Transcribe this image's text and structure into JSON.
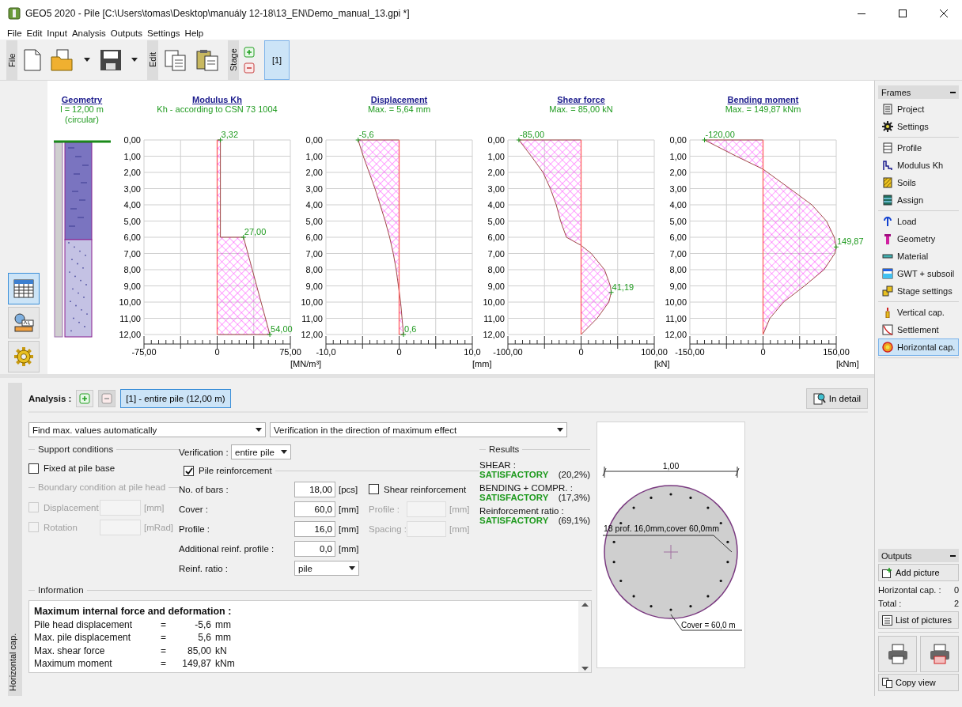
{
  "window": {
    "title": "GEO5 2020 - Pile [C:\\Users\\tomas\\Desktop\\manuály 12-18\\13_EN\\Demo_manual_13.gpi *]"
  },
  "menu": [
    "File",
    "Edit",
    "Input",
    "Analysis",
    "Outputs",
    "Settings",
    "Help"
  ],
  "toolbar": {
    "groups": [
      {
        "label": "File"
      },
      {
        "label": "Edit"
      },
      {
        "label": "Stage"
      }
    ],
    "stages": [
      {
        "label": "[1]",
        "selected": true
      }
    ]
  },
  "view_buttons": [
    {
      "kind": "table",
      "selected": true
    },
    {
      "kind": "labels",
      "selected": false
    },
    {
      "kind": "settings",
      "selected": false
    }
  ],
  "geometry": {
    "title": "Geometry",
    "lines": [
      "l = 12,00 m",
      "(circular)"
    ]
  },
  "charts": [
    {
      "subtitle": "Kh - according to CSN 73 1004",
      "chart_data": {
        "type": "area",
        "ref_lines": [
          {
            "axis": "x",
            "value": 0,
            "color": "#ff6060"
          }
        ],
        "title": "Modulus Kh",
        "xlabel": "[MN/m³]",
        "grid": true,
        "x": [
          0,
          3.32,
          3.32,
          27,
          54,
          0
        ],
        "xlim": [
          -75,
          75
        ],
        "ylim": [
          12,
          0
        ],
        "xticks": [
          {
            "value": -75,
            "label": "-75,00"
          },
          {
            "value": 0,
            "label": "0"
          },
          {
            "value": 75,
            "label": "75,00"
          }
        ],
        "yticks": [
          {
            "value": 0,
            "label": "0,00"
          },
          {
            "value": 1,
            "label": "1,00"
          },
          {
            "value": 2,
            "label": "2,00"
          },
          {
            "value": 3,
            "label": "3,00"
          },
          {
            "value": 4,
            "label": "4,00"
          },
          {
            "value": 5,
            "label": "5,00"
          },
          {
            "value": 6,
            "label": "6,00"
          },
          {
            "value": 7,
            "label": "7,00"
          },
          {
            "value": 8,
            "label": "8,00"
          },
          {
            "value": 9,
            "label": "9,00"
          },
          {
            "value": 10,
            "label": "10,00"
          },
          {
            "value": 11,
            "label": "11,00"
          },
          {
            "value": 12,
            "label": "12,00"
          }
        ],
        "series": [
          {
            "color": "#a04848",
            "values": [
              0,
              0,
              6,
              6,
              12,
              12
            ]
          }
        ],
        "annotations": [
          {
            "x": 3.32,
            "y": 0,
            "text": "3,32"
          },
          {
            "x": 27,
            "y": 6,
            "text": "27,00"
          },
          {
            "x": 54,
            "y": 12,
            "text": "54,00"
          }
        ]
      }
    },
    {
      "subtitle": "Max. = 5,64 mm",
      "chart_data": {
        "type": "area",
        "ref_lines": [
          {
            "axis": "x",
            "value": 0,
            "color": "#ff6060"
          }
        ],
        "title": "Displacement",
        "xlabel": "[mm]",
        "grid": true,
        "x": [
          0,
          -5.6,
          -4.9,
          -4.1,
          -3.3,
          -2.6,
          -1.9,
          -1.3,
          -0.8,
          -0.4,
          -0.1,
          0.2,
          0.4,
          0.6,
          0
        ],
        "xlim": [
          -10,
          10
        ],
        "ylim": [
          12,
          0
        ],
        "xticks": [
          {
            "value": -10,
            "label": "-10,0"
          },
          {
            "value": 0,
            "label": "0"
          },
          {
            "value": 10,
            "label": "10,0"
          }
        ],
        "yticks": [
          {
            "value": 0,
            "label": "0,00"
          },
          {
            "value": 1,
            "label": "1,00"
          },
          {
            "value": 2,
            "label": "2,00"
          },
          {
            "value": 3,
            "label": "3,00"
          },
          {
            "value": 4,
            "label": "4,00"
          },
          {
            "value": 5,
            "label": "5,00"
          },
          {
            "value": 6,
            "label": "6,00"
          },
          {
            "value": 7,
            "label": "7,00"
          },
          {
            "value": 8,
            "label": "8,00"
          },
          {
            "value": 9,
            "label": "9,00"
          },
          {
            "value": 10,
            "label": "10,00"
          },
          {
            "value": 11,
            "label": "11,00"
          },
          {
            "value": 12,
            "label": "12,00"
          }
        ],
        "series": [
          {
            "color": "#a04848",
            "values": [
              0,
              0,
              1,
              2,
              3,
              4,
              5,
              6,
              7,
              8,
              9,
              10,
              11,
              12,
              12
            ]
          }
        ],
        "annotations": [
          {
            "x": -5.6,
            "y": 0,
            "text": "-5,6"
          },
          {
            "x": 0.6,
            "y": 12,
            "text": "0,6"
          }
        ]
      }
    },
    {
      "subtitle": "Max. = 85,00 kN",
      "chart_data": {
        "type": "area",
        "ref_lines": [
          {
            "axis": "x",
            "value": 0,
            "color": "#ff6060"
          }
        ],
        "title": "Shear force",
        "xlabel": "[kN]",
        "grid": true,
        "x": [
          0,
          -85,
          -68,
          -52,
          -42,
          -34,
          -28,
          -20,
          0,
          14,
          32,
          40,
          41.19,
          38,
          22,
          0
        ],
        "xlim": [
          -100,
          100
        ],
        "ylim": [
          12,
          0
        ],
        "xticks": [
          {
            "value": -100,
            "label": "-100,00"
          },
          {
            "value": 0,
            "label": "0"
          },
          {
            "value": 100,
            "label": "100,00"
          }
        ],
        "yticks": [
          {
            "value": 0,
            "label": "0,00"
          },
          {
            "value": 1,
            "label": "1,00"
          },
          {
            "value": 2,
            "label": "2,00"
          },
          {
            "value": 3,
            "label": "3,00"
          },
          {
            "value": 4,
            "label": "4,00"
          },
          {
            "value": 5,
            "label": "5,00"
          },
          {
            "value": 6,
            "label": "6,00"
          },
          {
            "value": 7,
            "label": "7,00"
          },
          {
            "value": 8,
            "label": "8,00"
          },
          {
            "value": 9,
            "label": "9,00"
          },
          {
            "value": 10,
            "label": "10,00"
          },
          {
            "value": 11,
            "label": "11,00"
          },
          {
            "value": 12,
            "label": "12,00"
          }
        ],
        "series": [
          {
            "color": "#a04848",
            "values": [
              0,
              0,
              1,
              2,
              3,
              4,
              5,
              6,
              6.5,
              7,
              8,
              9,
              9.4,
              10,
              11,
              12
            ]
          }
        ],
        "annotations": [
          {
            "x": -85,
            "y": 0,
            "text": "-85,00"
          },
          {
            "x": 41.19,
            "y": 9.4,
            "text": "41,19"
          }
        ]
      }
    },
    {
      "subtitle": "Max. = 149,87 kNm",
      "chart_data": {
        "type": "area",
        "ref_lines": [
          {
            "axis": "x",
            "value": 0,
            "color": "#ff6060"
          }
        ],
        "title": "Bending moment",
        "xlabel": "[kNm]",
        "grid": true,
        "x": [
          0,
          -120,
          -55,
          0,
          55,
          100,
          130,
          146,
          149.87,
          147,
          125,
          85,
          42,
          14,
          0
        ],
        "xlim": [
          -150,
          150
        ],
        "ylim": [
          12,
          0
        ],
        "xticks": [
          {
            "value": -150,
            "label": "-150,00"
          },
          {
            "value": 0,
            "label": "0"
          },
          {
            "value": 150,
            "label": "150,00"
          }
        ],
        "yticks": [
          {
            "value": 0,
            "label": "0,00"
          },
          {
            "value": 1,
            "label": "1,00"
          },
          {
            "value": 2,
            "label": "2,00"
          },
          {
            "value": 3,
            "label": "3,00"
          },
          {
            "value": 4,
            "label": "4,00"
          },
          {
            "value": 5,
            "label": "5,00"
          },
          {
            "value": 6,
            "label": "6,00"
          },
          {
            "value": 7,
            "label": "7,00"
          },
          {
            "value": 8,
            "label": "8,00"
          },
          {
            "value": 9,
            "label": "9,00"
          },
          {
            "value": 10,
            "label": "10,00"
          },
          {
            "value": 11,
            "label": "11,00"
          },
          {
            "value": 12,
            "label": "12,00"
          }
        ],
        "series": [
          {
            "color": "#a04848",
            "values": [
              0,
              0,
              1,
              1.8,
              3,
              4,
              5,
              6,
              6.6,
              7,
              8,
              9,
              10,
              11,
              12
            ]
          }
        ],
        "annotations": [
          {
            "x": -120,
            "y": 0,
            "text": "-120,00"
          },
          {
            "x": 149.87,
            "y": 6.6,
            "text": "149,87"
          }
        ]
      }
    }
  ],
  "bottom_panel": {
    "tab": "Horizontal cap.",
    "analysis_label": "Analysis :",
    "remove_disabled": true,
    "analyses": [
      {
        "label": "[1] - entire pile (12,00 m)",
        "selected": true
      }
    ],
    "detail_button": "In detail",
    "mode_select": "Find max. values automatically",
    "direction_select": "Verification in the direction of maximum effect",
    "support": {
      "title": "Support conditions",
      "fixed_base": {
        "label": "Fixed at pile base",
        "checked": false
      },
      "head_title": "Boundary condition at pile head",
      "head_disabled": true,
      "head_rows": [
        {
          "label": "Displacement",
          "unit": "[mm]",
          "checked": false
        },
        {
          "label": "Rotation",
          "unit": "[mRad]",
          "checked": false
        }
      ]
    },
    "verification": {
      "label": "Verification  :",
      "value": "entire pile"
    },
    "reinforcement": {
      "label": "Pile reinforcement",
      "checked": true,
      "fields": [
        {
          "label": "No. of bars :",
          "value": "18,00",
          "unit": "[pcs]"
        },
        {
          "label": "Cover :",
          "value": "60,0",
          "unit": "[mm]"
        },
        {
          "label": "Profile :",
          "value": "16,0",
          "unit": "[mm]"
        },
        {
          "label": "Additional reinf. profile :",
          "value": "0,0",
          "unit": "[mm]"
        }
      ],
      "ratio": {
        "label": "Reinf. ratio :",
        "value": "pile"
      }
    },
    "shear_reinforcement": {
      "label": "Shear reinforcement",
      "checked": false,
      "fields": [
        {
          "label": "Profile :",
          "unit": "[mm]",
          "disabled": true
        },
        {
          "label": "Spacing :",
          "unit": "[mm]",
          "disabled": true
        }
      ]
    },
    "results": {
      "title": "Results",
      "items": [
        {
          "label": "SHEAR :",
          "verdict": "SATISFACTORY",
          "percent": "(20,2%)"
        },
        {
          "label": "BENDING + COMPR. :",
          "verdict": "SATISFACTORY",
          "percent": "(17,3%)"
        },
        {
          "label": "Reinforcement ratio :",
          "verdict": "SATISFACTORY",
          "percent": "(69,1%)"
        }
      ]
    },
    "information": {
      "title": "Information",
      "heading": "Maximum internal force and deformation :",
      "rows": [
        {
          "label": "Pile head displacement",
          "sign": "=",
          "value": "-5,6",
          "unit": "mm"
        },
        {
          "label": "Max. pile displacement",
          "sign": "=",
          "value": "5,6",
          "unit": "mm"
        },
        {
          "label": "Max. shear force",
          "sign": "=",
          "value": "85,00",
          "unit": "kN"
        },
        {
          "label": "Maximum moment",
          "sign": "=",
          "value": "149,87",
          "unit": "kNm"
        }
      ]
    },
    "cross_section": {
      "width_label": "1,00",
      "bars_label": "18 prof. 16,0mm,cover 60,0mm",
      "cover_label": "Cover = 60,0 m"
    }
  },
  "sidebar": {
    "title": "Frames",
    "groups": [
      {
        "items": [
          {
            "label": "Project",
            "selected": false
          },
          {
            "label": "Settings",
            "selected": false
          }
        ]
      },
      {
        "items": [
          {
            "label": "Profile",
            "selected": false
          },
          {
            "label": "Modulus Kh",
            "selected": false
          },
          {
            "label": "Soils",
            "selected": false
          },
          {
            "label": "Assign",
            "selected": false
          }
        ]
      },
      {
        "items": [
          {
            "label": "Load",
            "selected": false
          },
          {
            "label": "Geometry",
            "selected": false
          },
          {
            "label": "Material",
            "selected": false
          },
          {
            "label": "GWT + subsoil",
            "selected": false
          },
          {
            "label": "Stage settings",
            "selected": false
          }
        ]
      },
      {
        "items": [
          {
            "label": "Vertical cap.",
            "selected": false
          },
          {
            "label": "Settlement",
            "selected": false
          },
          {
            "label": "Horizontal cap.",
            "selected": true
          }
        ]
      }
    ]
  },
  "outputs": {
    "title": "Outputs",
    "add_button": "Add picture",
    "counts": [
      {
        "label": "Horizontal cap. :",
        "value": "0"
      },
      {
        "label": "Total :",
        "value": "2"
      }
    ],
    "list_button": "List of pictures",
    "copy_button": "Copy view"
  }
}
